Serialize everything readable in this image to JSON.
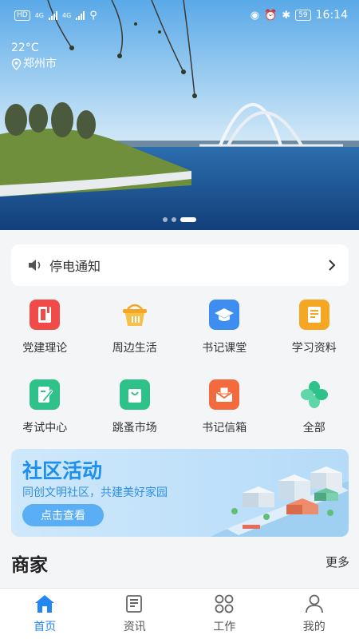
{
  "status_bar": {
    "time": "16:14",
    "battery": "59",
    "hd": "HD",
    "net1": "4G",
    "net2": "4G"
  },
  "weather": {
    "temperature": "22°C",
    "city": "郑州市"
  },
  "notice": {
    "text": "停电通知",
    "icon": "speaker-icon",
    "arrow": "chevron-right-icon"
  },
  "grid": [
    {
      "label": "党建理论",
      "icon": "book-icon",
      "color": "#f24949"
    },
    {
      "label": "周边生活",
      "icon": "basket-icon",
      "color": "#f5a623"
    },
    {
      "label": "书记课堂",
      "icon": "graduation-cap-icon",
      "color": "#3d8ef0"
    },
    {
      "label": "学习资料",
      "icon": "document-icon",
      "color": "#f5a623"
    },
    {
      "label": "考试中心",
      "icon": "exam-pen-icon",
      "color": "#2ec28a"
    },
    {
      "label": "跳蚤市场",
      "icon": "shopping-bag-icon",
      "color": "#2ec28a"
    },
    {
      "label": "书记信箱",
      "icon": "mailbox-icon",
      "color": "#f26a3d"
    },
    {
      "label": "全部",
      "icon": "all-icon",
      "color": "#2ec28a"
    }
  ],
  "banner": {
    "title": "社区活动",
    "subtitle": "同创文明社区，共建美好家园",
    "button": "点击查看"
  },
  "merchant": {
    "title": "商家",
    "more": "更多"
  },
  "tabbar": [
    {
      "label": "首页",
      "icon": "home-icon",
      "active": true
    },
    {
      "label": "资讯",
      "icon": "news-icon",
      "active": false
    },
    {
      "label": "工作",
      "icon": "apps-icon",
      "active": false
    },
    {
      "label": "我的",
      "icon": "user-icon",
      "active": false
    }
  ],
  "colors": {
    "primary": "#2486f0",
    "banner_title": "#1c8ff0"
  }
}
